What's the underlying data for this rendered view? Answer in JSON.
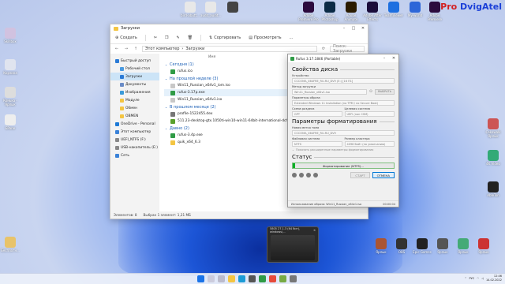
{
  "brand": {
    "pro": "Pro",
    "name": "DvigAtel"
  },
  "desktop_top_icons": [
    {
      "label": "bird-abutt...",
      "color": "#e8e8e8"
    },
    {
      "label": "audit_audit...",
      "color": "#e8e8e8"
    },
    {
      "label": "",
      "color": "#444"
    },
    {
      "label": "Adobe Premiere Pro",
      "color": "#2b0a3d"
    },
    {
      "label": "Adobe Photoshop",
      "color": "#0b2a45"
    },
    {
      "label": "Adobe Animate",
      "color": "#2a1b00"
    },
    {
      "label": "Adobe After Effects",
      "color": "#1a0c3a"
    },
    {
      "label": "TeamViewer",
      "color": "#1d6fe0"
    },
    {
      "label": "My-world",
      "color": "#2d66d8"
    },
    {
      "label": "Adobe Premiere",
      "color": "#2b0a3d"
    }
  ],
  "desktop_left_icons": [
    {
      "label": "Skillbox",
      "color": "#d1c2e0"
    },
    {
      "label": "Корзина",
      "color": "#e0e4ef"
    },
    {
      "label": "Конька - Ярлык",
      "color": "#ddd"
    },
    {
      "label": "EPane",
      "color": "#eee"
    },
    {
      "label": "Бесплатн...",
      "color": "#e8c36a"
    }
  ],
  "desktop_right_icons": [
    {
      "label": "Cakewalk Ярлык",
      "color": "#c55"
    },
    {
      "label": "4K Video",
      "color": "#3a7"
    },
    {
      "label": "AbleTon",
      "color": "#222"
    },
    {
      "label": "Ярлык",
      "color": "#a53"
    },
    {
      "label": "OBS",
      "color": "#333"
    },
    {
      "label": "Epic Games",
      "color": "#222"
    },
    {
      "label": "Ярлык",
      "color": "#555"
    },
    {
      "label": "Ярлык",
      "color": "#4a7"
    },
    {
      "label": "Ярлык",
      "color": "#c33"
    }
  ],
  "explorer": {
    "title": "Загрузки",
    "toolbar": {
      "new": "Создать",
      "sort": "Сортировать",
      "view": "Просмотреть",
      "more": "..."
    },
    "address": [
      "Этот компьютер",
      "Загрузки"
    ],
    "search_placeholder": "Поиск: Загрузки",
    "nav": [
      {
        "label": "Быстрый доступ",
        "color": "#2b7bd6",
        "indent": false,
        "active": false
      },
      {
        "label": "Рабочий стол",
        "color": "#4a9ae0",
        "indent": true,
        "active": false
      },
      {
        "label": "Загрузки",
        "color": "#2b7bd6",
        "indent": true,
        "active": true
      },
      {
        "label": "Документы",
        "color": "#6a8cc7",
        "indent": true,
        "active": false
      },
      {
        "label": "Изображения",
        "color": "#3a9ad9",
        "indent": true,
        "active": false
      },
      {
        "label": "Модуле",
        "color": "#f4c542",
        "indent": true,
        "active": false
      },
      {
        "label": "Обмен",
        "color": "#f4c542",
        "indent": true,
        "active": false
      },
      {
        "label": "OBMEN",
        "color": "#f4c542",
        "indent": true,
        "active": false
      },
      {
        "label": "OneDrive - Personal",
        "color": "#1e7ad6",
        "indent": false,
        "active": false
      },
      {
        "label": "Этот компьютер",
        "color": "#3a82d8",
        "indent": false,
        "active": false
      },
      {
        "label": "UEFI_NTFS (F:)",
        "color": "#888",
        "indent": false,
        "active": false
      },
      {
        "label": "USB-накопитель (E:)",
        "color": "#888",
        "indent": false,
        "active": false
      },
      {
        "label": "Сеть",
        "color": "#3a82d8",
        "indent": false,
        "active": false
      }
    ],
    "column_name": "Имя",
    "groups": [
      {
        "title": "Сегодня (1)",
        "files": [
          {
            "name": "rufus.ico",
            "color": "#2f9b46",
            "selected": false
          }
        ]
      },
      {
        "title": "На прошлой неделе (3)",
        "files": [
          {
            "name": "Win11_Russian_x64v1_iom.iso",
            "color": "#c8c8c8",
            "selected": false
          },
          {
            "name": "rufus-3.17p.exe",
            "color": "#2f9b46",
            "selected": true
          },
          {
            "name": "Win11_Russian_x64v1.iso",
            "color": "#c8c8c8",
            "selected": false
          }
        ]
      },
      {
        "title": "В прошлом месяце (2)",
        "files": [
          {
            "name": "profile-1522455.dex",
            "color": "#777",
            "selected": false
          },
          {
            "name": "511.23-desktop-gtx.1050ti-win10-win11-64bit-international-dch-whql.exe",
            "color": "#5aa02c",
            "selected": false
          }
        ]
      },
      {
        "title": "Давно (2)",
        "files": [
          {
            "name": "rufus-3.4p.exe",
            "color": "#2f9b46",
            "selected": false
          },
          {
            "name": "quik_x64_6.3",
            "color": "#f4c542",
            "selected": false
          }
        ]
      }
    ],
    "status": {
      "count": "Элементов: 8",
      "selected": "Выбран 1 элемент: 1,31 МБ"
    }
  },
  "rufus": {
    "title": "Rufus 3.17.1846 (Portable)",
    "section_drive": "Свойства диска",
    "device_label": "Устройство",
    "device_value": "CCCOMA_X64FRE_RU-RU_DV9 (E:) [16 ГБ]",
    "boot_label": "Метод загрузки",
    "boot_value": "Win11_Russian_x64v1.iso",
    "select_btn": "ВЫБРАТЬ",
    "image_label": "Параметры образа",
    "image_value": "Extended Windows 11 Installation (no TPM / no Secure Boot)",
    "part_label": "Схема раздела",
    "part_value": "GPT",
    "target_label": "Целевая система",
    "target_value": "UEFI (non CSM)",
    "section_format": "Параметры форматирования",
    "vol_label": "Новая метка тома",
    "vol_value": "CCCOMA_X64FRE_RU-RU_DV9",
    "fs_label": "Файловая система",
    "fs_value": "NTFS",
    "cluster_label": "Размер кластера",
    "cluster_value": "4096 байт (по умолчанию)",
    "adv_label": "Показать расширенные параметры форматирования",
    "section_status": "Статус",
    "progress_text": "Форматирование (NTFS)...",
    "progress": 0.02,
    "start_btn": "СТАРТ",
    "cancel_btn": "ОТМЕНА",
    "footer_left": "Использование образа: Win11_Russian_x64v1.iso",
    "footer_right": "00:00:04"
  },
  "thumb": {
    "title": "5805 27.1.3 (64 бит), windows\\..."
  },
  "clock": {
    "time": "12:46",
    "date": "14.02.2022",
    "lang": "РУС"
  }
}
